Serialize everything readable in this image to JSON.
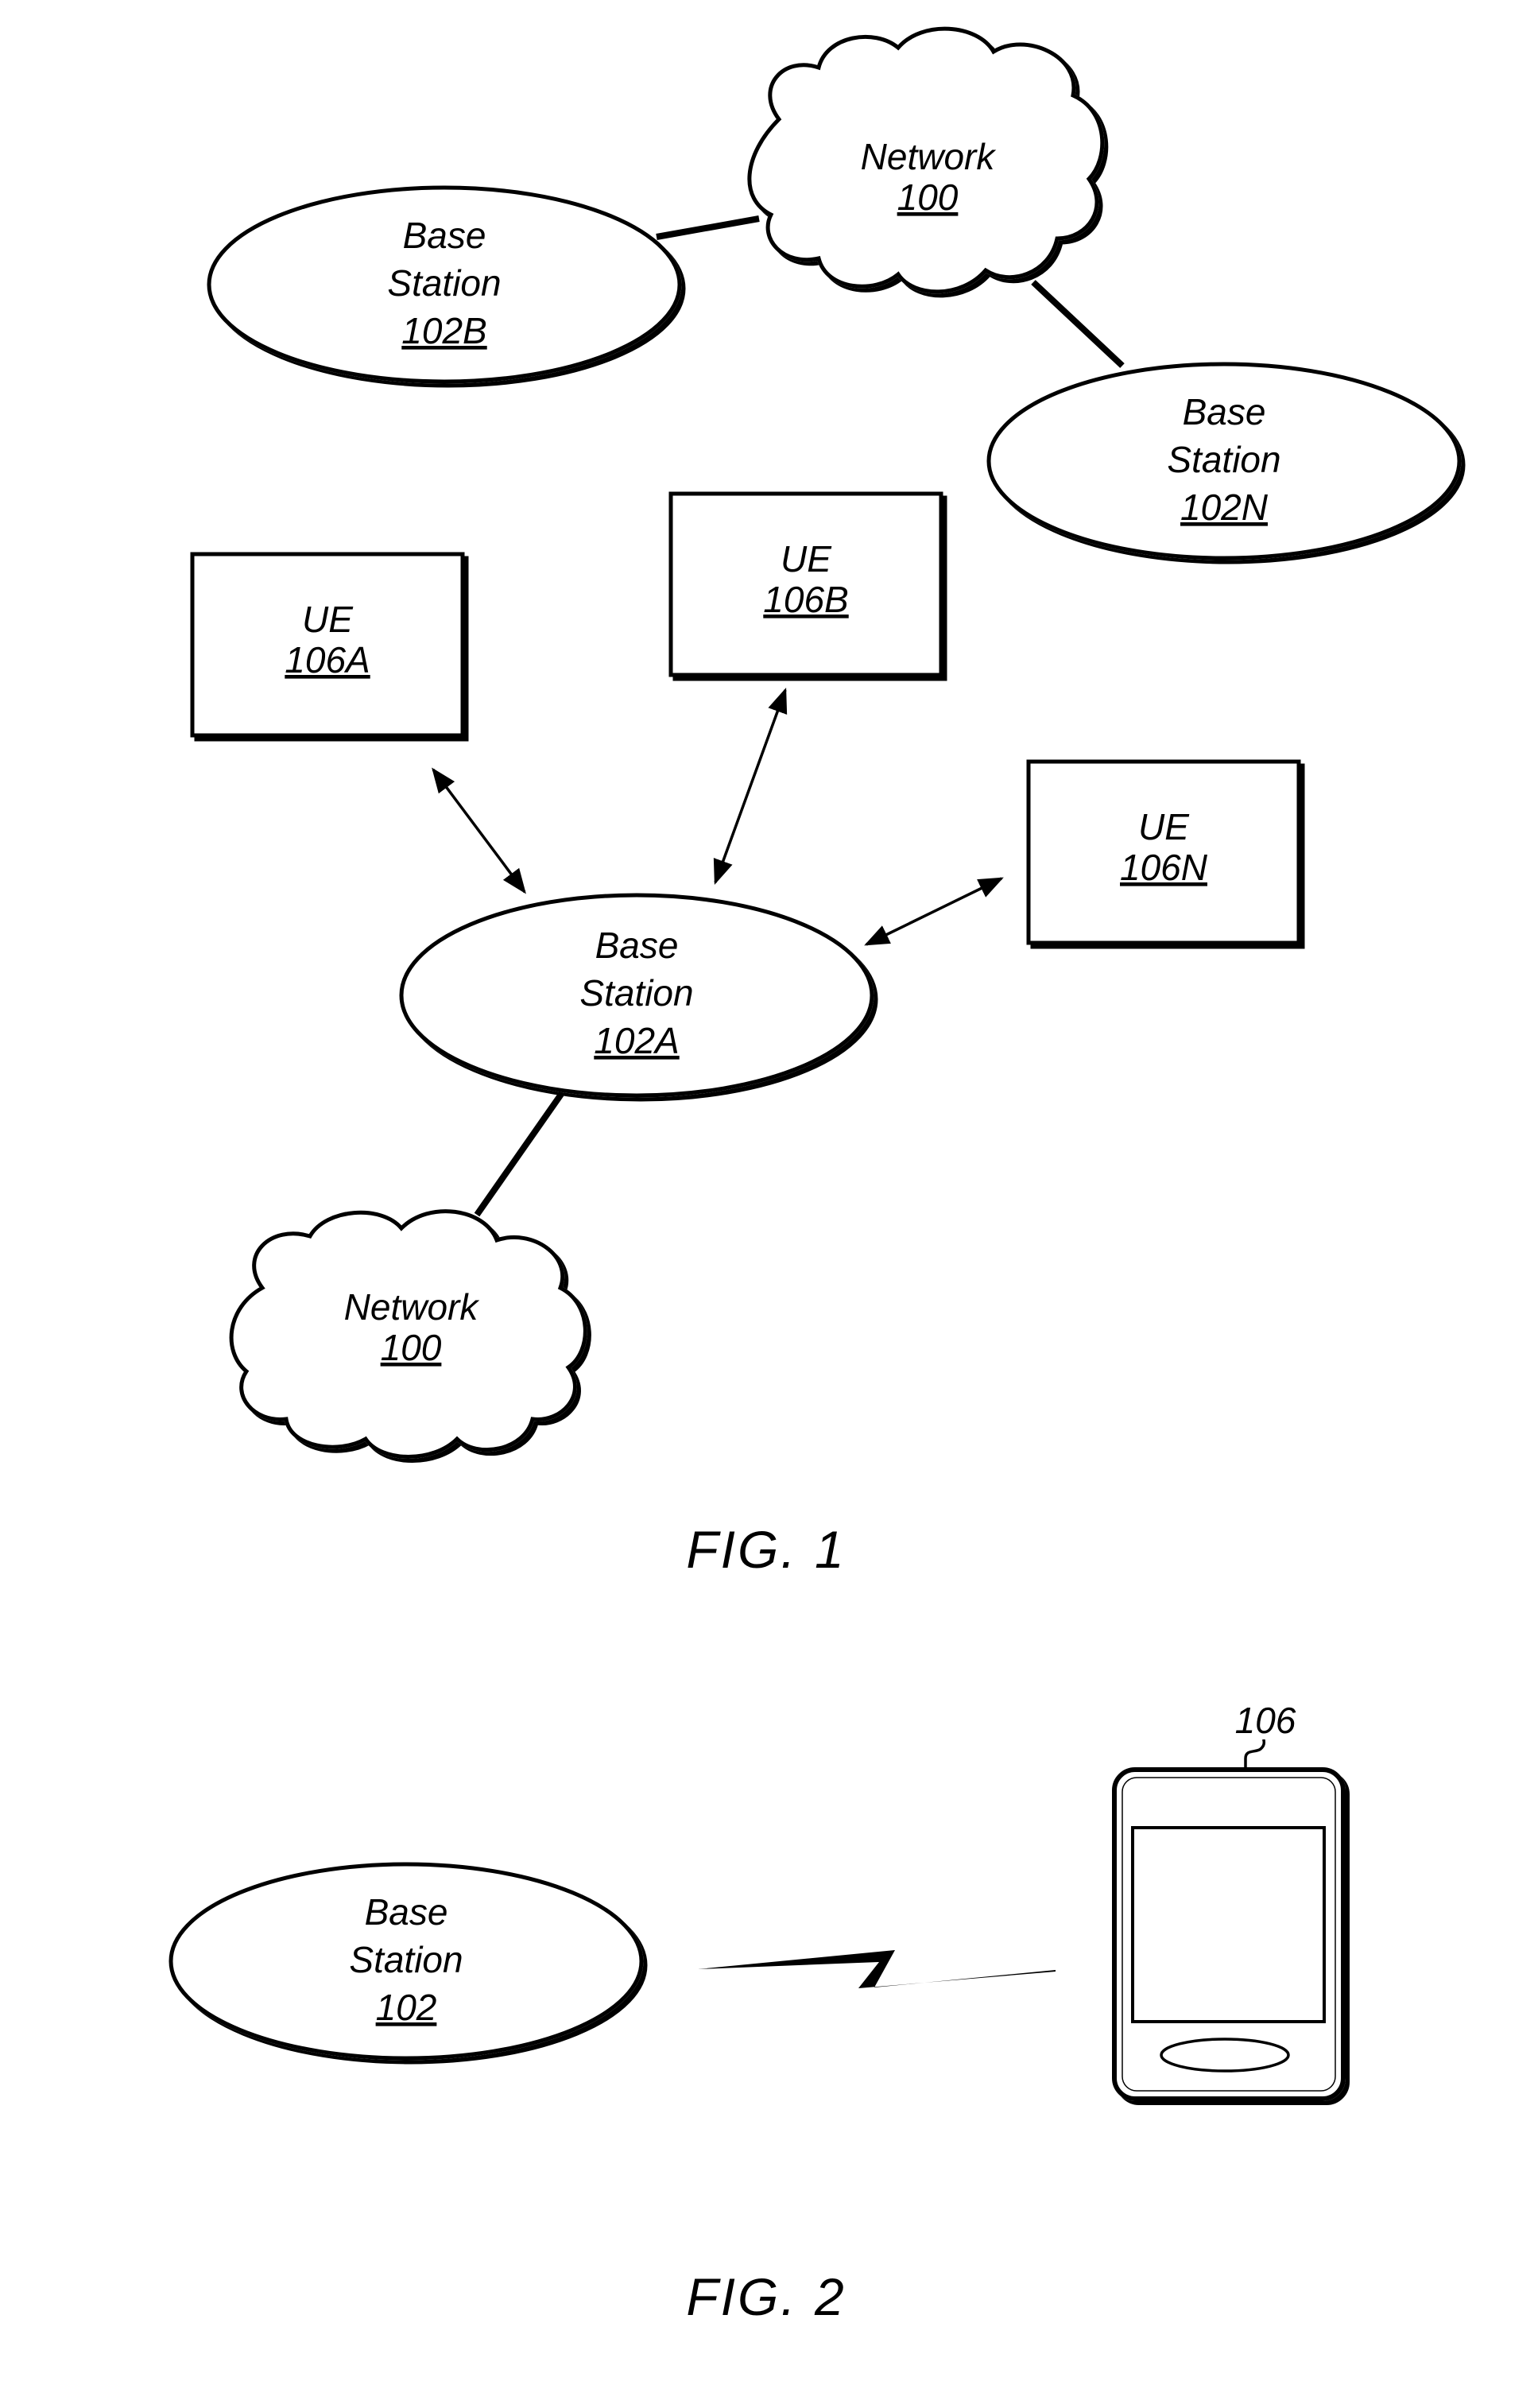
{
  "figure1": {
    "caption": "FIG. 1",
    "network_top": {
      "label": "Network",
      "ref": "100"
    },
    "network_bottom": {
      "label": "Network",
      "ref": "100"
    },
    "base_station_102b": {
      "line1": "Base",
      "line2": "Station",
      "ref": "102B"
    },
    "base_station_102n": {
      "line1": "Base",
      "line2": "Station",
      "ref": "102N"
    },
    "base_station_102a": {
      "line1": "Base",
      "line2": "Station",
      "ref": "102A"
    },
    "ue_106a": {
      "label": "UE",
      "ref": "106A"
    },
    "ue_106b": {
      "label": "UE",
      "ref": "106B"
    },
    "ue_106n": {
      "label": "UE",
      "ref": "106N"
    }
  },
  "figure2": {
    "caption": "FIG. 2",
    "base_station": {
      "line1": "Base",
      "line2": "Station",
      "ref": "102"
    },
    "device_ref": "106"
  }
}
